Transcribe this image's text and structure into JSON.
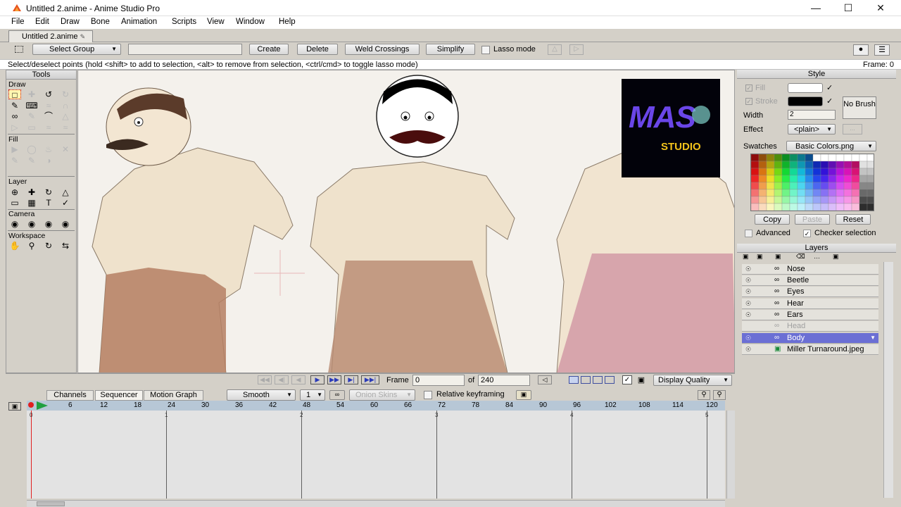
{
  "window": {
    "title": "Untitled 2.anime - Anime Studio Pro"
  },
  "menu": [
    "File",
    "Edit",
    "Draw",
    "Bone",
    "Animation",
    "Scripts",
    "View",
    "Window",
    "Help"
  ],
  "doc_tab": "Untitled 2.anime",
  "tool_options": {
    "select_group": "Select Group",
    "create": "Create",
    "delete": "Delete",
    "weld": "Weld Crossings",
    "simplify": "Simplify",
    "lasso": "Lasso mode"
  },
  "status": {
    "message": "Select/deselect points (hold <shift> to add to selection, <alt> to remove from selection, <ctrl/cmd> to toggle lasso mode)",
    "frame": "Frame: 0"
  },
  "tools": {
    "title": "Tools",
    "draw": "Draw",
    "fill": "Fill",
    "layer": "Layer",
    "camera": "Camera",
    "workspace": "Workspace"
  },
  "logo": {
    "line1": "MAS",
    "line2": "STUDIO"
  },
  "nav": {
    "frame_label": "Frame",
    "frame_value": "0",
    "of_label": "of",
    "total": "240",
    "display_quality": "Display Quality"
  },
  "timeline": {
    "tabs": [
      "Channels",
      "Sequencer",
      "Motion Graph"
    ],
    "smooth": "Smooth",
    "step": "1",
    "onion": "Onion Skins",
    "relative": "Relative keyframing",
    "ruler": [
      "6",
      "12",
      "18",
      "24",
      "30",
      "36",
      "42",
      "48",
      "54",
      "60",
      "66",
      "72",
      "78",
      "84",
      "90",
      "96",
      "102",
      "108",
      "114",
      "120"
    ],
    "seconds": [
      "0",
      "1",
      "2",
      "3",
      "4",
      "5"
    ]
  },
  "style": {
    "title": "Style",
    "fill": "Fill",
    "stroke": "Stroke",
    "width_label": "Width",
    "width_value": "2",
    "effect_label": "Effect",
    "effect_value": "<plain>",
    "no_brush": "No Brush",
    "swatches_label": "Swatches",
    "swatches_value": "Basic Colors.png",
    "copy": "Copy",
    "paste": "Paste",
    "reset": "Reset",
    "advanced": "Advanced",
    "checker": "Checker selection"
  },
  "layers": {
    "title": "Layers",
    "items": [
      {
        "name": "Nose"
      },
      {
        "name": "Beetle"
      },
      {
        "name": "Eyes"
      },
      {
        "name": "Hear"
      },
      {
        "name": "Ears"
      },
      {
        "name": "Head"
      },
      {
        "name": "Body"
      },
      {
        "name": "Miller Turnaround.jpeg"
      }
    ]
  }
}
